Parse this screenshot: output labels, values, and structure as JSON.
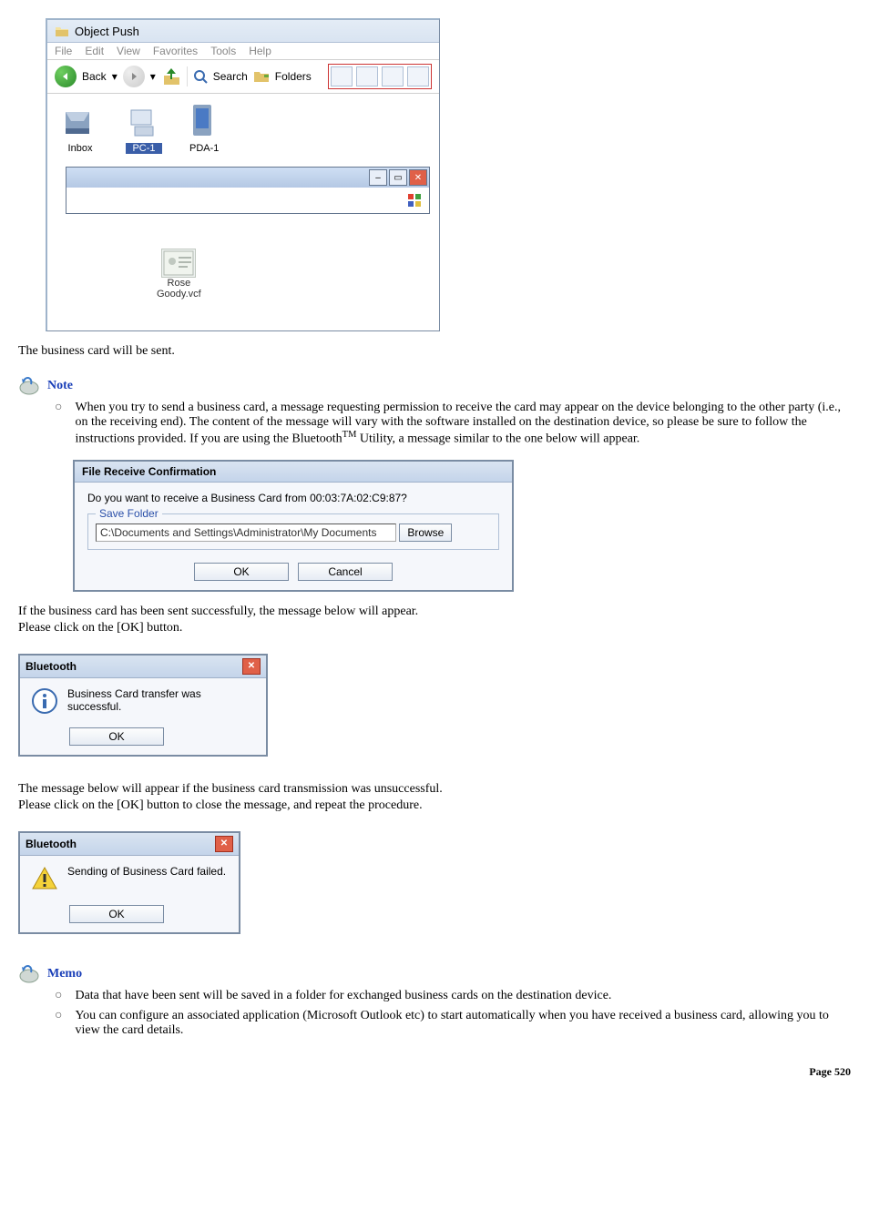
{
  "explorer": {
    "title": "Object Push",
    "menus": [
      "File",
      "Edit",
      "View",
      "Favorites",
      "Tools",
      "Help"
    ],
    "back_label": "Back",
    "search_label": "Search",
    "folders_label": "Folders",
    "icons": {
      "inbox": "Inbox",
      "pc": "PC-1",
      "pda": "PDA-1"
    },
    "vcf_label": "Rose\nGoody.vcf"
  },
  "para1": "The business card will be sent.",
  "note_heading": "Note",
  "note_bullet_pre": "When you try to send a business card, a message requesting permission to receive the card may appear on the device belonging to the other party (i.e., on the receiving end). The content of the message will vary with the software installed on the destination device, so please be sure to follow the instructions provided. If you are using the Bluetooth",
  "note_bullet_post": " Utility, a message similar to the one below will appear.",
  "tm": "TM",
  "confirm_dialog": {
    "title": "File Receive Confirmation",
    "question": "Do you want to receive a Business Card from 00:03:7A:02:C9:87?",
    "legend": "Save Folder",
    "path": "C:\\Documents and Settings\\Administrator\\My Documents",
    "browse": "Browse",
    "ok": "OK",
    "cancel": "Cancel"
  },
  "para2": "If the business card has been sent successfully, the message below will appear.",
  "para3": "Please click on the [OK] button.",
  "success_box": {
    "title": "Bluetooth",
    "msg": "Business Card transfer was successful.",
    "ok": "OK"
  },
  "para4": "The message below will appear if the business card transmission was unsuccessful.",
  "para5": "Please click on the [OK] button to close the message, and repeat the procedure.",
  "fail_box": {
    "title": "Bluetooth",
    "msg": "Sending of Business Card failed.",
    "ok": "OK"
  },
  "memo_heading": "Memo",
  "memo_items": [
    "Data that have been sent will be saved in a folder for exchanged business cards on the destination device.",
    "You can configure an associated application (Microsoft Outlook etc) to start automatically when you have received a business card, allowing you to view the card details."
  ],
  "page_label": "Page",
  "page_number": "520"
}
